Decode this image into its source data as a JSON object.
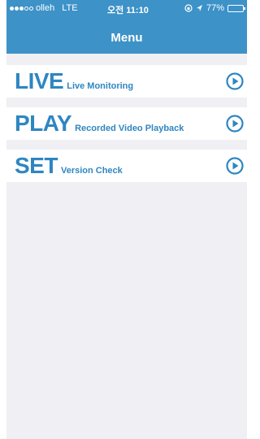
{
  "status_bar": {
    "carrier": "olleh",
    "network": "LTE",
    "time": "오전 11:10",
    "battery": "77%",
    "battery_level": 0.77,
    "signal_bars": 3
  },
  "nav": {
    "title": "Menu"
  },
  "menu": {
    "items": [
      {
        "title": "LIVE",
        "subtitle": "Live Monitoring",
        "icon": "play-circle-icon"
      },
      {
        "title": "PLAY",
        "subtitle": "Recorded Video Playback",
        "icon": "play-circle-icon"
      },
      {
        "title": "SET",
        "subtitle": "Version Check",
        "icon": "play-circle-icon"
      }
    ]
  },
  "colors": {
    "header_bg": "#3d92c8",
    "accent": "#2e86c1",
    "page_bg": "#efeff4"
  }
}
